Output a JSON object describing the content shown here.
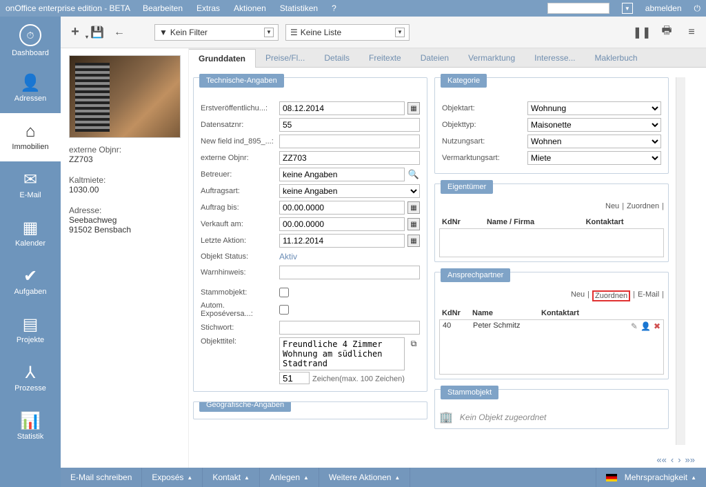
{
  "topbar": {
    "title": "onOffice enterprise edition - BETA",
    "menu": [
      "Bearbeiten",
      "Extras",
      "Aktionen",
      "Statistiken",
      "?"
    ],
    "logout": "abmelden"
  },
  "sidebar": {
    "items": [
      {
        "label": "Dashboard",
        "icon": "◷"
      },
      {
        "label": "Adressen",
        "icon": "👤"
      },
      {
        "label": "Immobilien",
        "icon": "⌂"
      },
      {
        "label": "E-Mail",
        "icon": "✉"
      },
      {
        "label": "Kalender",
        "icon": "▦"
      },
      {
        "label": "Aufgaben",
        "icon": "✔"
      },
      {
        "label": "Projekte",
        "icon": "▤"
      },
      {
        "label": "Prozesse",
        "icon": "⅄"
      },
      {
        "label": "Statistik",
        "icon": "⫾⫾⫾"
      }
    ],
    "activeIndex": 2
  },
  "toolbar": {
    "filter_label": "Kein Filter",
    "list_label": "Keine Liste"
  },
  "info": {
    "externObj_lbl": "externe Objnr:",
    "externObj_val": "ZZ703",
    "kaltmiete_lbl": "Kaltmiete:",
    "kaltmiete_val": "1030.00",
    "adresse_lbl": "Adresse:",
    "adresse_l1": "Seebachweg",
    "adresse_l2": "91502 Bensbach"
  },
  "tabs": [
    "Grunddaten",
    "Preise/Fl...",
    "Details",
    "Freitexte",
    "Dateien",
    "Vermarktung",
    "Interesse...",
    "Maklerbuch"
  ],
  "tech": {
    "hdr": "Technische-Angaben",
    "erstver_lbl": "Erstveröffentlichu...:",
    "erstver_val": "08.12.2014",
    "datensatz_lbl": "Datensatznr:",
    "datensatz_val": "55",
    "newfield_lbl": "New field ind_895_...:",
    "newfield_val": "",
    "extern_lbl": "externe Objnr:",
    "extern_val": "ZZ703",
    "betreuer_lbl": "Betreuer:",
    "betreuer_val": "keine Angaben",
    "auftragsart_lbl": "Auftragsart:",
    "auftragsart_val": "keine Angaben",
    "auftragbis_lbl": "Auftrag bis:",
    "auftragbis_val": "00.00.0000",
    "verkauft_lbl": "Verkauft am:",
    "verkauft_val": "00.00.0000",
    "letzteaktion_lbl": "Letzte Aktion:",
    "letzteaktion_val": "11.12.2014",
    "status_lbl": "Objekt Status:",
    "status_val": "Aktiv",
    "warn_lbl": "Warnhinweis:",
    "warn_val": "",
    "stamm_lbl": "Stammobjekt:",
    "autoexp_lbl": "Autom. Exposéversa...:",
    "stichwort_lbl": "Stichwort:",
    "stichwort_val": "",
    "titel_lbl": "Objekttitel:",
    "titel_val": "Freundliche 4 Zimmer Wohnung am südlichen Stadtrand",
    "char_count": "51",
    "char_hint": "Zeichen(max. 100 Zeichen)"
  },
  "geo_hdr": "Geografische-Angaben",
  "kategorie": {
    "hdr": "Kategorie",
    "objektart_lbl": "Objektart:",
    "objektart_val": "Wohnung",
    "objekttyp_lbl": "Objekttyp:",
    "objekttyp_val": "Maisonette",
    "nutzung_lbl": "Nutzungsart:",
    "nutzung_val": "Wohnen",
    "vermarktung_lbl": "Vermarktungsart:",
    "vermarktung_val": "Miete"
  },
  "eigen": {
    "hdr": "Eigentümer",
    "neu": "Neu",
    "zuordnen": "Zuordnen",
    "th1": "KdNr",
    "th2": "Name / Firma",
    "th3": "Kontaktart"
  },
  "anspr": {
    "hdr": "Ansprechpartner",
    "neu": "Neu",
    "zuordnen": "Zuordnen",
    "email": "E-Mail",
    "th1": "KdNr",
    "th2": "Name",
    "th3": "Kontaktart",
    "kdnr": "40",
    "name": "Peter Schmitz"
  },
  "stammobj": {
    "hdr": "Stammobjekt",
    "txt": "Kein Objekt zugeordnet"
  },
  "actionbar": {
    "items": [
      "E-Mail schreiben",
      "Exposés",
      "Kontakt",
      "Anlegen",
      "Weitere Aktionen"
    ],
    "lang": "Mehrsprachigkeit"
  }
}
